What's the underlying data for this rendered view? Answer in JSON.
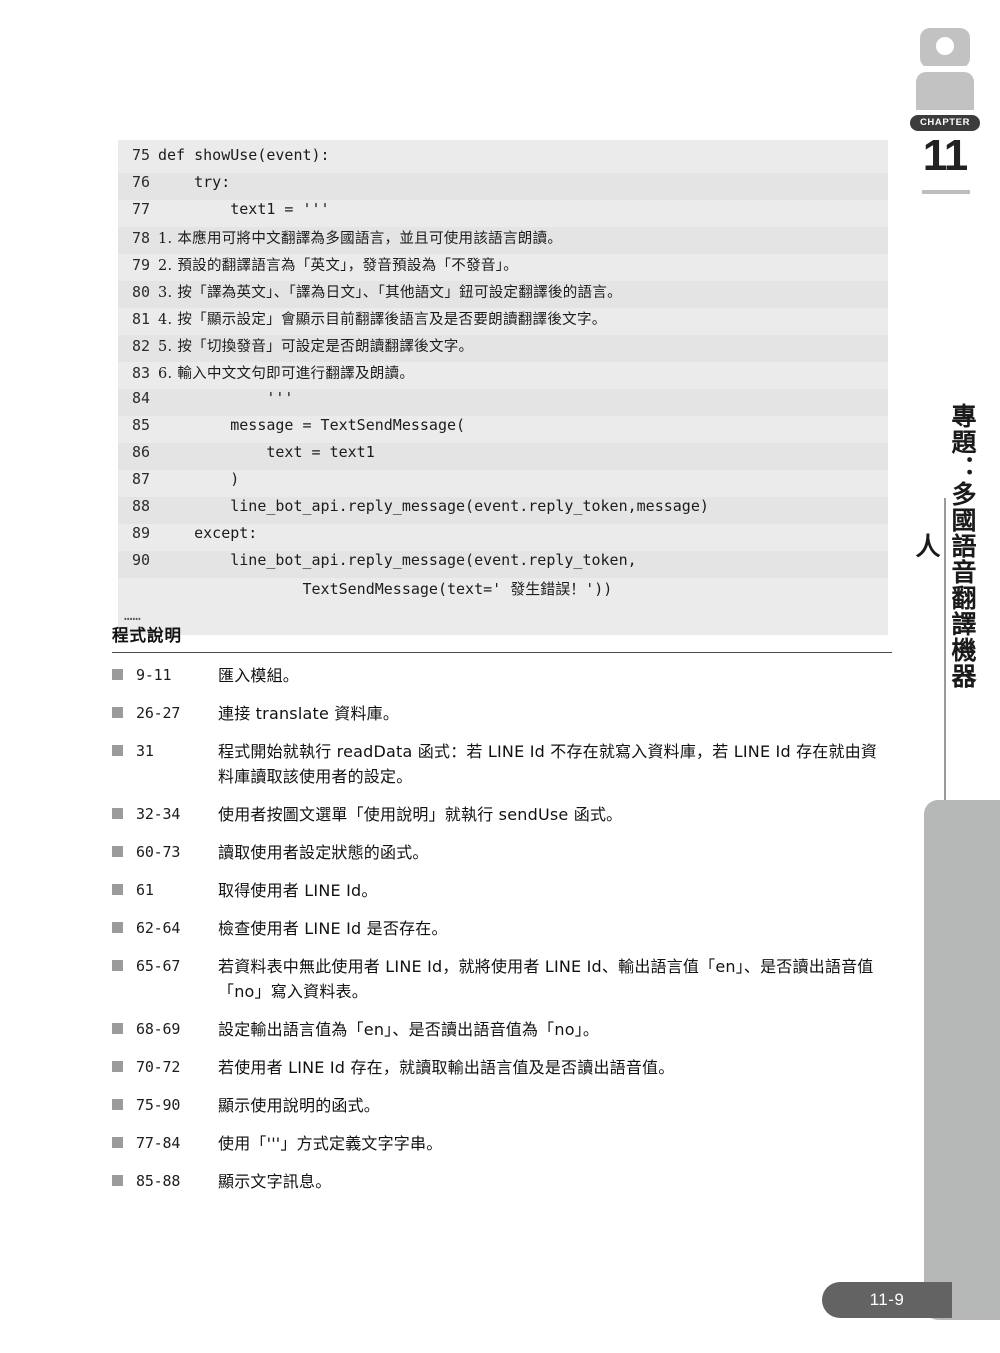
{
  "chapter_rail": {
    "badge_label": "CHAPTER",
    "chapter_number": "11",
    "chapter_title": "專題：多國語音翻譯機器人",
    "page_number": "11-9",
    "icon_name": "robot-head-icon"
  },
  "code_block": {
    "trailing_ellipsis": "……",
    "lines": [
      {
        "no": "75",
        "text": "def showUse(event):",
        "cjk": false
      },
      {
        "no": "76",
        "text": "    try:",
        "cjk": false
      },
      {
        "no": "77",
        "text": "        text1 = '''",
        "cjk": false
      },
      {
        "no": "78",
        "text": "1. 本應用可將中文翻譯為多國語言，並且可使用該語言朗讀。",
        "cjk": true
      },
      {
        "no": "79",
        "text": "2. 預設的翻譯語言為「英文」，發音預設為「不發音」。",
        "cjk": true
      },
      {
        "no": "80",
        "text": "3. 按「譯為英文」、「譯為日文」、「其他語文」鈕可設定翻譯後的語言。",
        "cjk": true
      },
      {
        "no": "81",
        "text": "4. 按「顯示設定」會顯示目前翻譯後語言及是否要朗讀翻譯後文字。",
        "cjk": true
      },
      {
        "no": "82",
        "text": "5. 按「切換發音」可設定是否朗讀翻譯後文字。",
        "cjk": true
      },
      {
        "no": "83",
        "text": "6. 輸入中文文句即可進行翻譯及朗讀。",
        "cjk": true
      },
      {
        "no": "84",
        "text": "            '''",
        "cjk": false
      },
      {
        "no": "85",
        "text": "        message = TextSendMessage(",
        "cjk": false
      },
      {
        "no": "86",
        "text": "            text = text1",
        "cjk": false
      },
      {
        "no": "87",
        "text": "        )",
        "cjk": false
      },
      {
        "no": "88",
        "text": "        line_bot_api.reply_message(event.reply_token,message)",
        "cjk": false
      },
      {
        "no": "89",
        "text": "    except:",
        "cjk": false
      },
      {
        "no": "90",
        "text": "        line_bot_api.reply_message(event.reply_token,",
        "cjk": false
      },
      {
        "no": "",
        "text": "                TextSendMessage(text=' 發生錯誤！'))",
        "cjk": false
      }
    ]
  },
  "explanation": {
    "title": "程式說明",
    "items": [
      {
        "range": "9-11",
        "desc": "匯入模組。"
      },
      {
        "range": "26-27",
        "desc": "連接 translate 資料庫。"
      },
      {
        "range": "31",
        "desc": "程式開始就執行 readData 函式：若 LINE  Id 不存在就寫入資料庫，若 LINE  Id 存在就由資料庫讀取該使用者的設定。"
      },
      {
        "range": "32-34",
        "desc": "使用者按圖文選單「使用說明」就執行 sendUse 函式。"
      },
      {
        "range": "60-73",
        "desc": "讀取使用者設定狀態的函式。"
      },
      {
        "range": "61",
        "desc": "取得使用者 LINE  Id。"
      },
      {
        "range": "62-64",
        "desc": "檢查使用者 LINE  Id 是否存在。"
      },
      {
        "range": "65-67",
        "desc": "若資料表中無此使用者 LINE  Id，就將使用者 LINE  Id、輸出語言值「en」、是否讀出語音值「no」寫入資料表。"
      },
      {
        "range": "68-69",
        "desc": "設定輸出語言值為「en」、是否讀出語音值為「no」。"
      },
      {
        "range": "70-72",
        "desc": "若使用者 LINE  Id 存在，就讀取輸出語言值及是否讀出語音值。"
      },
      {
        "range": "75-90",
        "desc": "顯示使用說明的函式。"
      },
      {
        "range": "77-84",
        "desc": "使用「'''」方式定義文字字串。"
      },
      {
        "range": "85-88",
        "desc": "顯示文字訊息。"
      }
    ]
  }
}
